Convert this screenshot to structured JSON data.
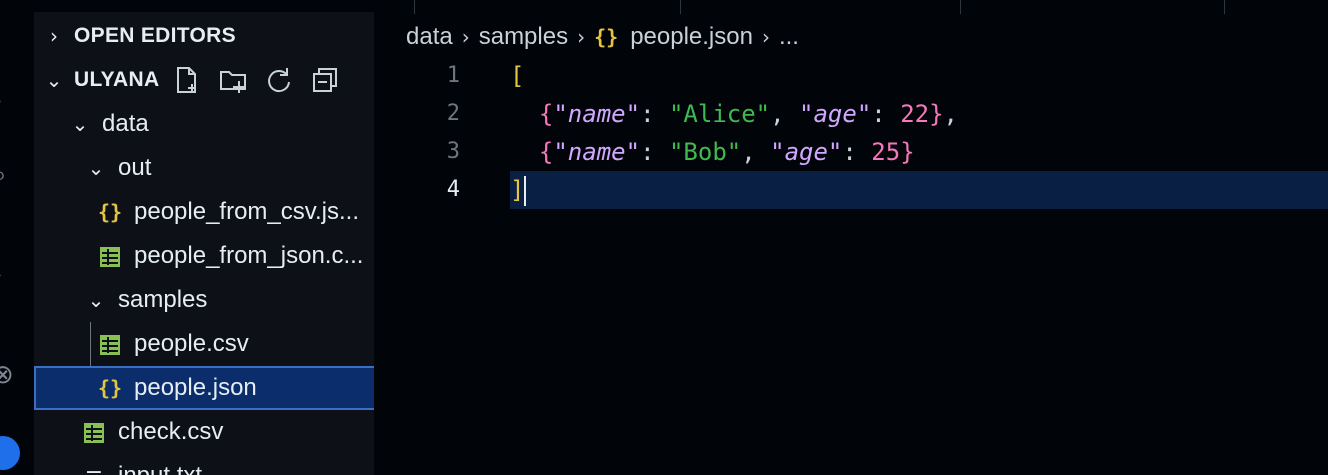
{
  "sidebar": {
    "open_editors_label": "OPEN EDITORS",
    "workspace_label": "ULYANA",
    "tree": [
      {
        "label": "data",
        "kind": "folder"
      },
      {
        "label": "out",
        "kind": "folder"
      },
      {
        "label": "people_from_csv.js...",
        "kind": "json"
      },
      {
        "label": "people_from_json.c...",
        "kind": "csv"
      },
      {
        "label": "samples",
        "kind": "folder"
      },
      {
        "label": "people.csv",
        "kind": "csv"
      },
      {
        "label": "people.json",
        "kind": "json",
        "selected": true
      },
      {
        "label": "check.csv",
        "kind": "csv"
      },
      {
        "label": "input.txt",
        "kind": "txt"
      }
    ]
  },
  "breadcrumb": {
    "parts": [
      "data",
      "samples",
      "people.json",
      "..."
    ],
    "file_icon": "{}"
  },
  "editor": {
    "line_numbers": [
      "1",
      "2",
      "3",
      "4"
    ],
    "current_line": 4,
    "lines": [
      {
        "open": "["
      },
      {
        "key1": "\"name\"",
        "val1": "\"Alice\"",
        "key2": "\"age\"",
        "val2": "22",
        "trail": ","
      },
      {
        "key1": "\"name\"",
        "val1": "\"Bob\"",
        "key2": "\"age\"",
        "val2": "25",
        "trail": ""
      },
      {
        "close": "]"
      }
    ]
  },
  "icons": {
    "json": "json-braces-icon",
    "csv": "table-grid-icon",
    "txt": "text-lines-icon"
  },
  "colors": {
    "accent": "#3b6fc4",
    "json_icon": "#e3c443",
    "csv_icon": "#89c053",
    "string": "#3fb950",
    "number": "#f778ba",
    "key": "#d2a8ff"
  }
}
